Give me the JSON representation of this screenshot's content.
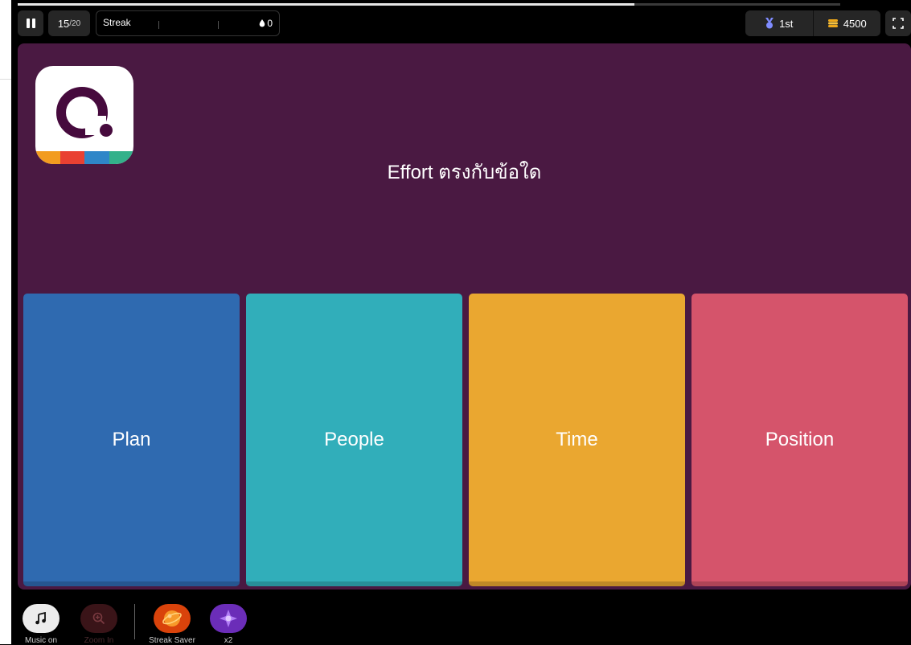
{
  "progress": {
    "current": 15,
    "total": 20,
    "counter_current": "15",
    "counter_total": "/20"
  },
  "streak": {
    "label": "Streak",
    "count": "0"
  },
  "rank": {
    "label": "1st"
  },
  "coins": {
    "label": "4500"
  },
  "question": {
    "text": "Effort ตรงกับข้อใด"
  },
  "options": [
    {
      "label": "Plan",
      "color": "#2f6ab0"
    },
    {
      "label": "People",
      "color": "#31aeba"
    },
    {
      "label": "Time",
      "color": "#eaa730"
    },
    {
      "label": "Position",
      "color": "#d5546b"
    }
  ],
  "powerups": {
    "music": {
      "label": "Music on",
      "icon": "music-note-icon"
    },
    "zoom": {
      "label": "Zoom In",
      "icon": "zoom-in-icon"
    },
    "streak_saver": {
      "label": "Streak Saver",
      "icon": "streak-saver-icon"
    },
    "x2": {
      "label": "x2",
      "icon": "x2-icon"
    }
  },
  "colors": {
    "stage_bg": "#4a1942",
    "logo_stripes": [
      "#f29c1f",
      "#e94132",
      "#2f86c8",
      "#33b18a"
    ]
  }
}
